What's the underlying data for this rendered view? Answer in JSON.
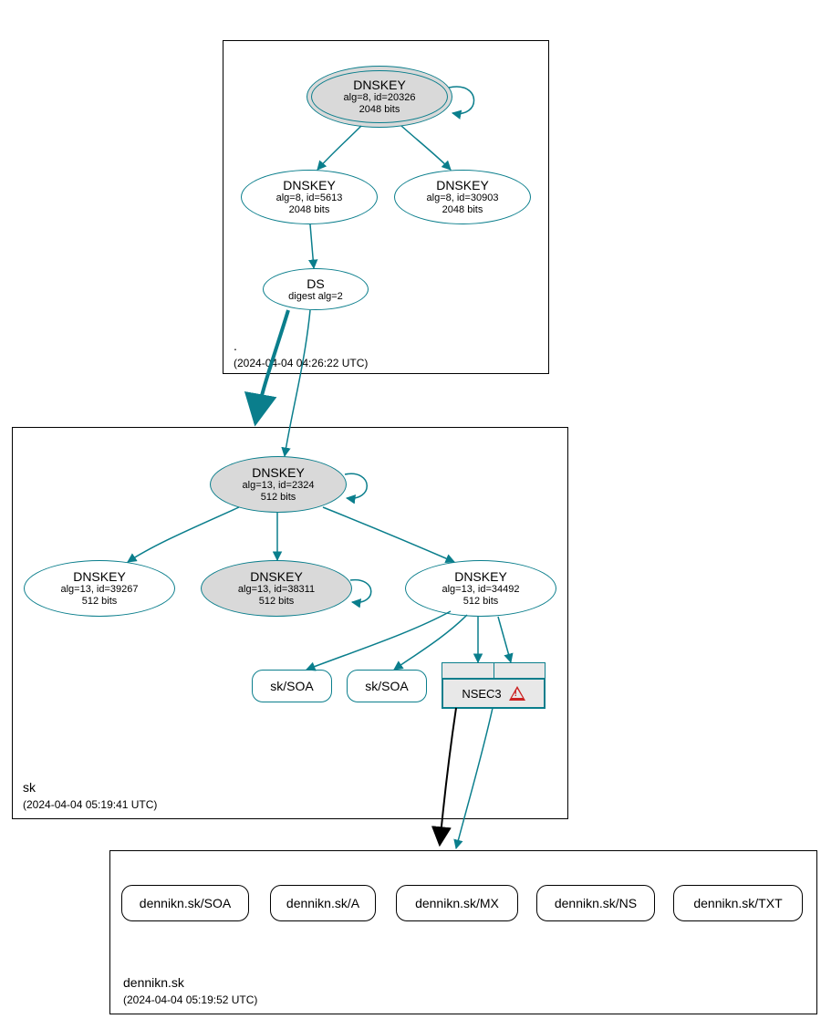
{
  "colors": {
    "teal": "#0a7e8c",
    "fill": "#d9d9d9",
    "black": "#000000",
    "warn": "#c22"
  },
  "zones": {
    "root": {
      "name": ".",
      "ts": "(2024-04-04 04:26:22 UTC)"
    },
    "sk": {
      "name": "sk",
      "ts": "(2024-04-04 05:19:41 UTC)"
    },
    "dom": {
      "name": "dennikn.sk",
      "ts": "(2024-04-04 05:19:52 UTC)"
    }
  },
  "nodes": {
    "root_ksk": {
      "title": "DNSKEY",
      "l1": "alg=8, id=20326",
      "l2": "2048 bits"
    },
    "root_zsk1": {
      "title": "DNSKEY",
      "l1": "alg=8, id=5613",
      "l2": "2048 bits"
    },
    "root_zsk2": {
      "title": "DNSKEY",
      "l1": "alg=8, id=30903",
      "l2": "2048 bits"
    },
    "root_ds": {
      "title": "DS",
      "l1": "digest alg=2",
      "l2": ""
    },
    "sk_ksk": {
      "title": "DNSKEY",
      "l1": "alg=13, id=2324",
      "l2": "512 bits"
    },
    "sk_a": {
      "title": "DNSKEY",
      "l1": "alg=13, id=39267",
      "l2": "512 bits"
    },
    "sk_b": {
      "title": "DNSKEY",
      "l1": "alg=13, id=38311",
      "l2": "512 bits"
    },
    "sk_c": {
      "title": "DNSKEY",
      "l1": "alg=13, id=34492",
      "l2": "512 bits"
    },
    "sk_soa1": {
      "label": "sk/SOA"
    },
    "sk_soa2": {
      "label": "sk/SOA"
    },
    "nsec3": {
      "label": "NSEC3"
    },
    "d_soa": {
      "label": "dennikn.sk/SOA"
    },
    "d_a": {
      "label": "dennikn.sk/A"
    },
    "d_mx": {
      "label": "dennikn.sk/MX"
    },
    "d_ns": {
      "label": "dennikn.sk/NS"
    },
    "d_txt": {
      "label": "dennikn.sk/TXT"
    }
  }
}
